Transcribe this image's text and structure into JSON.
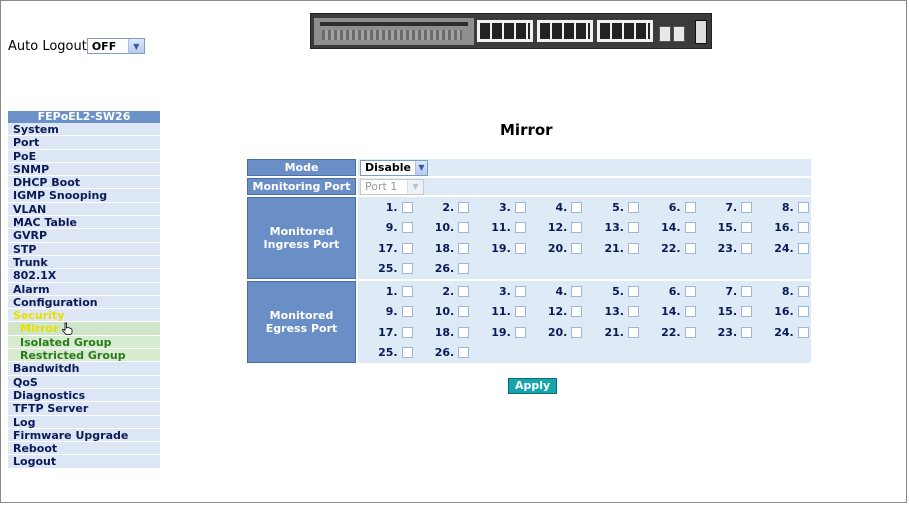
{
  "session": {
    "auto_logout_label": "Auto Logout",
    "auto_logout_value": "OFF"
  },
  "menu": {
    "title": "FEPoEL2-SW26",
    "items": [
      {
        "label": "System",
        "type": "item"
      },
      {
        "label": "Port",
        "type": "item"
      },
      {
        "label": "PoE",
        "type": "item"
      },
      {
        "label": "SNMP",
        "type": "item"
      },
      {
        "label": "DHCP Boot",
        "type": "item"
      },
      {
        "label": "IGMP Snooping",
        "type": "item"
      },
      {
        "label": "VLAN",
        "type": "item"
      },
      {
        "label": "MAC Table",
        "type": "item"
      },
      {
        "label": "GVRP",
        "type": "item"
      },
      {
        "label": "STP",
        "type": "item"
      },
      {
        "label": "Trunk",
        "type": "item"
      },
      {
        "label": "802.1X",
        "type": "item"
      },
      {
        "label": "Alarm",
        "type": "item"
      },
      {
        "label": "Configuration",
        "type": "item"
      },
      {
        "label": "Security",
        "type": "section"
      },
      {
        "label": "Mirror",
        "type": "sub-active"
      },
      {
        "label": "Isolated Group",
        "type": "sub"
      },
      {
        "label": "Restricted Group",
        "type": "sub"
      },
      {
        "label": "Bandwitdh",
        "type": "item"
      },
      {
        "label": "QoS",
        "type": "item"
      },
      {
        "label": "Diagnostics",
        "type": "item"
      },
      {
        "label": "TFTP Server",
        "type": "item"
      },
      {
        "label": "Log",
        "type": "item"
      },
      {
        "label": "Firmware Upgrade",
        "type": "item"
      },
      {
        "label": "Reboot",
        "type": "item"
      },
      {
        "label": "Logout",
        "type": "item"
      }
    ]
  },
  "mirror": {
    "title": "Mirror",
    "mode_label": "Mode",
    "mode_value": "Disable",
    "monitoring_port_label": "Monitoring Port",
    "monitoring_port_value": "Port 1",
    "ingress_label": "Monitored Ingress Port",
    "egress_label": "Monitored Egress Port",
    "ports": [
      "1.",
      "2.",
      "3.",
      "4.",
      "5.",
      "6.",
      "7.",
      "8.",
      "9.",
      "10.",
      "11.",
      "12.",
      "13.",
      "14.",
      "15.",
      "16.",
      "17.",
      "18.",
      "19.",
      "20.",
      "21.",
      "22.",
      "23.",
      "24.",
      "25.",
      "26."
    ],
    "apply_label": "Apply"
  },
  "icons": {
    "select_arrow": "chevron-down-icon",
    "pointer": "hand-pointer-icon"
  },
  "colors": {
    "header_blue": "#6a8ec6",
    "cell_bg": "#dfeaf7",
    "apply": "#16a4ad",
    "security": "#e8e000"
  }
}
